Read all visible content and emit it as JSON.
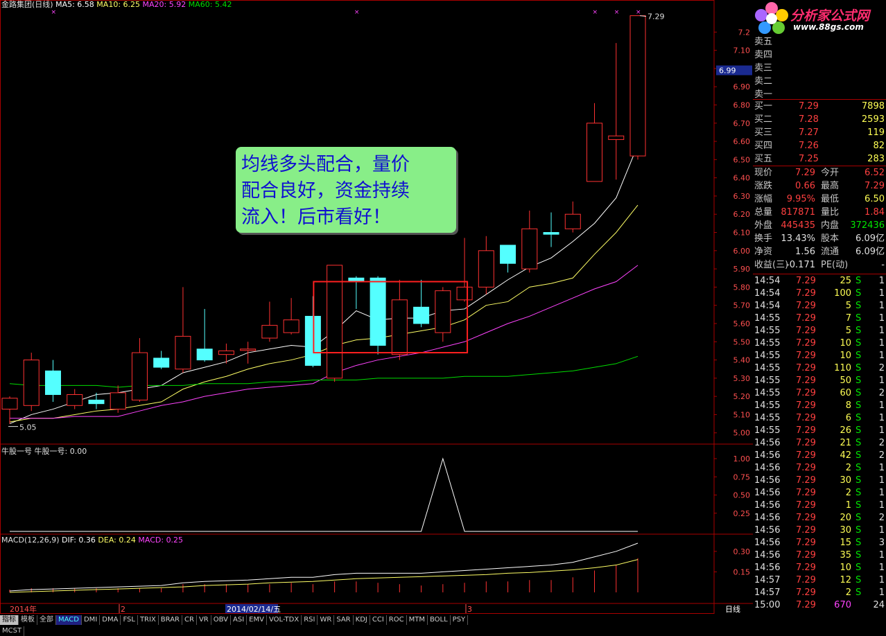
{
  "header": {
    "stock": "金路集团(日线)",
    "ma": [
      {
        "label": "MA5: 6.58",
        "color": "#ffffff"
      },
      {
        "label": "MA10: 6.25",
        "color": "#ffff66"
      },
      {
        "label": "MA20: 5.92",
        "color": "#ff44ff"
      },
      {
        "label": "MA60: 5.42",
        "color": "#00dd00"
      }
    ]
  },
  "chart_data": [
    {
      "type": "candlestick",
      "ylim": [
        4.98,
        7.3
      ],
      "yticks": [
        "7.2",
        "7.10",
        "7.00",
        "6.90",
        "6.80",
        "6.70",
        "6.60",
        "6.50",
        "6.40",
        "6.30",
        "6.20",
        "6.10",
        "6.00",
        "5.90",
        "5.80",
        "5.70",
        "5.60",
        "5.50",
        "5.40",
        "5.30",
        "5.20",
        "5.10",
        "5.00"
      ],
      "candles": [
        {
          "o": 5.13,
          "h": 5.2,
          "l": 5.05,
          "c": 5.19
        },
        {
          "o": 5.15,
          "h": 5.44,
          "l": 5.12,
          "c": 5.4
        },
        {
          "o": 5.34,
          "h": 5.4,
          "l": 5.17,
          "c": 5.21
        },
        {
          "o": 5.15,
          "h": 5.24,
          "l": 5.13,
          "c": 5.21
        },
        {
          "o": 5.18,
          "h": 5.22,
          "l": 5.13,
          "c": 5.16
        },
        {
          "o": 5.13,
          "h": 5.26,
          "l": 5.11,
          "c": 5.22
        },
        {
          "o": 5.18,
          "h": 5.52,
          "l": 5.17,
          "c": 5.44
        },
        {
          "o": 5.41,
          "h": 5.45,
          "l": 5.35,
          "c": 5.36
        },
        {
          "o": 5.35,
          "h": 5.8,
          "l": 5.33,
          "c": 5.53
        },
        {
          "o": 5.46,
          "h": 5.68,
          "l": 5.39,
          "c": 5.4
        },
        {
          "o": 5.43,
          "h": 5.49,
          "l": 5.38,
          "c": 5.45
        },
        {
          "o": 5.46,
          "h": 5.5,
          "l": 5.38,
          "c": 5.46
        },
        {
          "o": 5.52,
          "h": 5.72,
          "l": 5.5,
          "c": 5.59
        },
        {
          "o": 5.55,
          "h": 5.74,
          "l": 5.54,
          "c": 5.62
        },
        {
          "o": 5.64,
          "h": 5.75,
          "l": 5.36,
          "c": 5.37
        },
        {
          "o": 5.3,
          "h": 5.92,
          "l": 5.28,
          "c": 5.92
        },
        {
          "o": 5.85,
          "h": 5.86,
          "l": 5.68,
          "c": 5.83
        },
        {
          "o": 5.85,
          "h": 5.86,
          "l": 5.43,
          "c": 5.48
        },
        {
          "o": 5.43,
          "h": 5.84,
          "l": 5.4,
          "c": 5.73
        },
        {
          "o": 5.69,
          "h": 5.84,
          "l": 5.58,
          "c": 5.6
        },
        {
          "o": 5.55,
          "h": 5.8,
          "l": 5.5,
          "c": 5.78
        },
        {
          "o": 5.73,
          "h": 6.07,
          "l": 5.72,
          "c": 5.8
        },
        {
          "o": 5.8,
          "h": 6.08,
          "l": 5.76,
          "c": 6.0
        },
        {
          "o": 6.03,
          "h": 6.03,
          "l": 5.88,
          "c": 5.93
        },
        {
          "o": 5.9,
          "h": 6.22,
          "l": 5.88,
          "c": 6.12
        },
        {
          "o": 6.1,
          "h": 6.21,
          "l": 6.02,
          "c": 6.09
        },
        {
          "o": 6.12,
          "h": 6.27,
          "l": 6.1,
          "c": 6.2
        },
        {
          "o": 6.38,
          "h": 6.81,
          "l": 6.38,
          "c": 6.7
        },
        {
          "o": 6.61,
          "h": 7.14,
          "l": 6.39,
          "c": 6.63
        },
        {
          "o": 6.52,
          "h": 7.29,
          "l": 6.5,
          "c": 7.29
        }
      ],
      "ma_series": [
        {
          "name": "MA5",
          "color": "#ffffff",
          "values": [
            5.05,
            5.1,
            5.13,
            5.17,
            5.21,
            5.22,
            5.24,
            5.26,
            5.33,
            5.36,
            5.39,
            5.44,
            5.46,
            5.48,
            5.47,
            5.56,
            5.67,
            5.62,
            5.63,
            5.63,
            5.67,
            5.68,
            5.76,
            5.84,
            5.91,
            5.96,
            6.05,
            6.15,
            6.29,
            6.58
          ]
        },
        {
          "name": "MA10",
          "color": "#ffff66",
          "values": [
            5.06,
            5.08,
            5.08,
            5.1,
            5.12,
            5.13,
            5.15,
            5.17,
            5.24,
            5.28,
            5.31,
            5.35,
            5.38,
            5.4,
            5.43,
            5.48,
            5.51,
            5.52,
            5.54,
            5.56,
            5.58,
            5.62,
            5.7,
            5.72,
            5.8,
            5.82,
            5.85,
            5.98,
            6.1,
            6.25
          ]
        },
        {
          "name": "MA20",
          "color": "#ff44ff",
          "values": [
            5.08,
            5.08,
            5.08,
            5.09,
            5.09,
            5.09,
            5.12,
            5.15,
            5.17,
            5.2,
            5.22,
            5.24,
            5.25,
            5.26,
            5.27,
            5.33,
            5.37,
            5.4,
            5.42,
            5.44,
            5.47,
            5.5,
            5.55,
            5.6,
            5.64,
            5.69,
            5.74,
            5.79,
            5.83,
            5.92
          ]
        },
        {
          "name": "MA60",
          "color": "#00dd00",
          "values": [
            5.27,
            5.26,
            5.26,
            5.26,
            5.26,
            5.25,
            5.26,
            5.26,
            5.26,
            5.27,
            5.27,
            5.27,
            5.28,
            5.28,
            5.29,
            5.29,
            5.29,
            5.3,
            5.3,
            5.3,
            5.3,
            5.31,
            5.31,
            5.31,
            5.32,
            5.33,
            5.34,
            5.36,
            5.38,
            5.42
          ]
        }
      ],
      "annotations": [
        "7.29",
        "5.05"
      ],
      "price_marker": "6.99"
    },
    {
      "type": "line",
      "title": "牛股一号",
      "series_label": "牛股一号: 0.00",
      "yticks": [
        "1.00",
        "0.75",
        "0.50",
        "0.25"
      ],
      "ylim": [
        0,
        1.0
      ],
      "values": [
        0,
        0,
        0,
        0,
        0,
        0,
        0,
        0,
        0,
        0,
        0,
        0,
        0,
        0,
        0,
        0,
        0,
        0,
        0,
        0,
        1,
        0,
        0,
        0,
        0,
        0,
        0,
        0,
        0,
        0
      ]
    },
    {
      "type": "line",
      "title": "MACD(12,26,9)",
      "legend": [
        {
          "label": "DIF: 0.36",
          "color": "#ffffff"
        },
        {
          "label": "DEA: 0.24",
          "color": "#ffff66"
        },
        {
          "label": "MACD: 0.25",
          "color": "#ff44ff"
        }
      ],
      "yticks": [
        "0.30",
        "0.15"
      ],
      "ylim": [
        0,
        0.36
      ],
      "dif": [
        0.01,
        0.02,
        0.025,
        0.03,
        0.035,
        0.04,
        0.045,
        0.05,
        0.07,
        0.08,
        0.085,
        0.09,
        0.1,
        0.11,
        0.11,
        0.13,
        0.14,
        0.14,
        0.14,
        0.14,
        0.15,
        0.16,
        0.17,
        0.18,
        0.19,
        0.2,
        0.22,
        0.26,
        0.3,
        0.36
      ],
      "dea": [
        0.0,
        0.005,
        0.01,
        0.015,
        0.02,
        0.025,
        0.03,
        0.035,
        0.04,
        0.05,
        0.055,
        0.06,
        0.07,
        0.075,
        0.08,
        0.09,
        0.1,
        0.105,
        0.11,
        0.115,
        0.12,
        0.125,
        0.13,
        0.14,
        0.145,
        0.155,
        0.165,
        0.18,
        0.2,
        0.24
      ],
      "macd": [
        0.02,
        0.03,
        0.03,
        0.03,
        0.03,
        0.03,
        0.03,
        0.03,
        0.06,
        0.06,
        0.06,
        0.06,
        0.06,
        0.07,
        0.06,
        0.08,
        0.08,
        0.07,
        0.06,
        0.05,
        0.06,
        0.07,
        0.08,
        0.08,
        0.09,
        0.09,
        0.11,
        0.16,
        0.2,
        0.25
      ]
    }
  ],
  "axis": {
    "dates": [
      "2014年",
      "2",
      "2014/02/14/五",
      "3"
    ],
    "period": "日线"
  },
  "callout": {
    "lines": [
      "均线多头配合，量价",
      "配合良好，资金持续",
      "流入！后市看好！"
    ]
  },
  "logo": {
    "title": "分析家公式网",
    "url": "www.88gs.com"
  },
  "sell_orders": [
    {
      "label": "卖五",
      "price": "",
      "vol": ""
    },
    {
      "label": "卖四",
      "price": "",
      "vol": ""
    },
    {
      "label": "卖三",
      "price": "",
      "vol": ""
    },
    {
      "label": "卖二",
      "price": "",
      "vol": ""
    },
    {
      "label": "卖一",
      "price": "",
      "vol": ""
    }
  ],
  "buy_orders": [
    {
      "label": "买一",
      "price": "7.29",
      "vol": "7898"
    },
    {
      "label": "买二",
      "price": "7.28",
      "vol": "2593"
    },
    {
      "label": "买三",
      "price": "7.27",
      "vol": "119"
    },
    {
      "label": "买四",
      "price": "7.26",
      "vol": "82"
    },
    {
      "label": "买五",
      "price": "7.25",
      "vol": "283"
    }
  ],
  "quote": [
    {
      "l1": "现价",
      "v1": "7.29",
      "c1": "red",
      "l2": "今开",
      "v2": "6.52",
      "c2": "red"
    },
    {
      "l1": "涨跌",
      "v1": "0.66",
      "c1": "red",
      "l2": "最高",
      "v2": "7.29",
      "c2": "red"
    },
    {
      "l1": "涨幅",
      "v1": "9.95%",
      "c1": "red",
      "l2": "最低",
      "v2": "6.50",
      "c2": "yel"
    },
    {
      "l1": "总量",
      "v1": "817871",
      "c1": "red",
      "l2": "量比",
      "v2": "1.84",
      "c2": "red"
    },
    {
      "l1": "外盘",
      "v1": "445435",
      "c1": "red",
      "l2": "内盘",
      "v2": "372436",
      "c2": "grn"
    },
    {
      "l1": "换手",
      "v1": "13.43%",
      "c1": "wht",
      "l2": "股本",
      "v2": "6.09亿",
      "c2": "wht"
    },
    {
      "l1": "净资",
      "v1": "1.56",
      "c1": "wht",
      "l2": "流通",
      "v2": "6.09亿",
      "c2": "wht"
    },
    {
      "l1": "收益(三)",
      "v1": "-0.171",
      "c1": "wht",
      "l2": "PE(动)",
      "v2": "-",
      "c2": "wht"
    }
  ],
  "ticks": [
    {
      "t": "14:54",
      "p": "7.29",
      "v": "25",
      "s": "S",
      "n": "1"
    },
    {
      "t": "14:54",
      "p": "7.29",
      "v": "100",
      "s": "S",
      "n": "1"
    },
    {
      "t": "14:54",
      "p": "7.29",
      "v": "5",
      "s": "S",
      "n": "1"
    },
    {
      "t": "14:55",
      "p": "7.29",
      "v": "7",
      "s": "S",
      "n": "1"
    },
    {
      "t": "14:55",
      "p": "7.29",
      "v": "5",
      "s": "S",
      "n": "1"
    },
    {
      "t": "14:55",
      "p": "7.29",
      "v": "10",
      "s": "S",
      "n": "1"
    },
    {
      "t": "14:55",
      "p": "7.29",
      "v": "10",
      "s": "S",
      "n": "1"
    },
    {
      "t": "14:55",
      "p": "7.29",
      "v": "110",
      "s": "S",
      "n": "2"
    },
    {
      "t": "14:55",
      "p": "7.29",
      "v": "50",
      "s": "S",
      "n": "1"
    },
    {
      "t": "14:55",
      "p": "7.29",
      "v": "60",
      "s": "S",
      "n": "2"
    },
    {
      "t": "14:55",
      "p": "7.29",
      "v": "8",
      "s": "S",
      "n": "1"
    },
    {
      "t": "14:55",
      "p": "7.29",
      "v": "6",
      "s": "S",
      "n": "1"
    },
    {
      "t": "14:55",
      "p": "7.29",
      "v": "26",
      "s": "S",
      "n": "1"
    },
    {
      "t": "14:56",
      "p": "7.29",
      "v": "21",
      "s": "S",
      "n": "2"
    },
    {
      "t": "14:56",
      "p": "7.29",
      "v": "42",
      "s": "S",
      "n": "2"
    },
    {
      "t": "14:56",
      "p": "7.29",
      "v": "2",
      "s": "S",
      "n": "1"
    },
    {
      "t": "14:56",
      "p": "7.29",
      "v": "30",
      "s": "S",
      "n": "1"
    },
    {
      "t": "14:56",
      "p": "7.29",
      "v": "2",
      "s": "S",
      "n": "1"
    },
    {
      "t": "14:56",
      "p": "7.29",
      "v": "1",
      "s": "S",
      "n": "1"
    },
    {
      "t": "14:56",
      "p": "7.29",
      "v": "20",
      "s": "S",
      "n": "2"
    },
    {
      "t": "14:56",
      "p": "7.29",
      "v": "30",
      "s": "S",
      "n": "1"
    },
    {
      "t": "14:56",
      "p": "7.29",
      "v": "15",
      "s": "S",
      "n": "3"
    },
    {
      "t": "14:56",
      "p": "7.29",
      "v": "35",
      "s": "S",
      "n": "1"
    },
    {
      "t": "14:56",
      "p": "7.29",
      "v": "10",
      "s": "S",
      "n": "1"
    },
    {
      "t": "14:57",
      "p": "7.29",
      "v": "12",
      "s": "S",
      "n": "1"
    },
    {
      "t": "14:57",
      "p": "7.29",
      "v": "2",
      "s": "S",
      "n": "1"
    },
    {
      "t": "15:00",
      "p": "7.29",
      "v": "670",
      "s": "",
      "n": "24"
    }
  ],
  "tabs": [
    "指标",
    "模板",
    "全部",
    "MACD",
    "DMI",
    "DMA",
    "FSL",
    "TRIX",
    "BRAR",
    "CR",
    "VR",
    "OBV",
    "ASI",
    "EMV",
    "VOL-TDX",
    "RSI",
    "WR",
    "SAR",
    "KDJ",
    "CCI",
    "ROC",
    "MTM",
    "BOLL",
    "PSY",
    "MCST"
  ]
}
